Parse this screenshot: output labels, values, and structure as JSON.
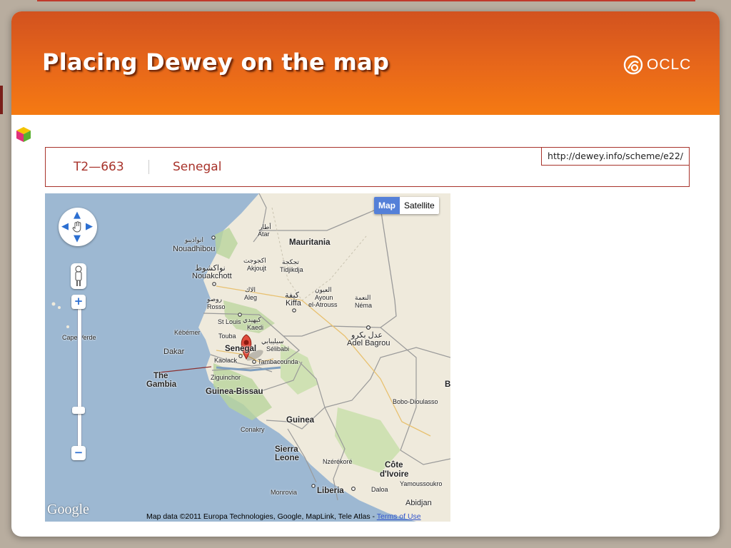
{
  "slide": {
    "title": "Placing Dewey on the map",
    "brand": "OCLC"
  },
  "dewey_record": {
    "notation": "T2—663",
    "caption": "Senegal",
    "uri": "http://dewey.info/scheme/e22/"
  },
  "map": {
    "type_controls": {
      "map": "Map",
      "satellite": "Satellite",
      "active": "Map"
    },
    "zoom_in": "+",
    "zoom_out": "−",
    "logo": "Google",
    "attribution": "Map data ©2011 Europa Technologies, Google, MapLink, Tele Atlas - ",
    "terms_link": "Terms of Use",
    "marker_icon": "red-map-pin",
    "labels": {
      "mauritania": "Mauritania",
      "nouadhibou_ar": "انواذيبو",
      "nouadhibou": "Nouadhibou",
      "atar_ar": "أطار",
      "atar": "Atar",
      "akjoujt_ar": "اكجوجت",
      "akjoujt": "Akjoujt",
      "tidjikdja_ar": "تجكجة",
      "tidjikdja": "Tidjikdja",
      "nouakchott_ar": "نواكشوط",
      "nouakchott": "Nouakchott",
      "aleg_ar": "الاك",
      "aleg": "Aleg",
      "kiffa_ar": "كيفة",
      "kiffa": "Kiffa",
      "ayoun_ar": "العيون",
      "ayoun": "Ayoun",
      "el_atrouss": "el-Atrouss",
      "nema_ar": "النعمة",
      "nema": "Néma",
      "rosso_ar": "روصو",
      "rosso": "Rosso",
      "st_louis": "St Louis",
      "kaedi_ar": "كيهيدي",
      "kaedi": "Kaedi",
      "kebemer": "Kébémer",
      "touba": "Touba",
      "selibabi_ar": "سيليبابي",
      "selibabi": "Sélibabi",
      "adel_bagrou_ar": "عدل بكرو",
      "adel_bagrou": "Adel Bagrou",
      "dakar": "Dakar",
      "senegal": "Senegal",
      "kaolack": "Kaolack",
      "tambacounda": "Tambacounda",
      "the": "The",
      "gambia": "Gambia",
      "ziguinchor": "Ziguinchor",
      "guinea_bissau": "Guinea-Bissau",
      "cape_verde": "Cape Verde",
      "guinea": "Guinea",
      "conakry": "Conakry",
      "sierra": "Sierra",
      "leone": "Leone",
      "nzerekore": "Nzérékoré",
      "cote": "Côte",
      "divoire": "d'Ivoire",
      "bobo_dioulasso": "Bobo-Dioulasso",
      "yamoussoukro": "Yamoussoukro",
      "monrovia": "Monrovia",
      "liberia": "Liberia",
      "daloa": "Daloa",
      "abidjan": "Abidjan",
      "edge_b": "B"
    }
  },
  "colors": {
    "header_top": "#d2521f",
    "header_bottom": "#f57a12",
    "accent_red": "#a8332b",
    "water": "#9db8d2",
    "land": "#efeadc"
  }
}
